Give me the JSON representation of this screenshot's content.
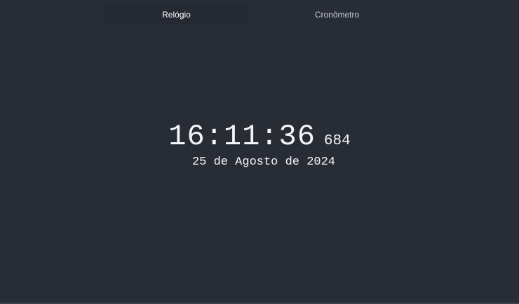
{
  "tabs": [
    {
      "label": "Relógio",
      "active": true
    },
    {
      "label": "Cronômetro",
      "active": false
    }
  ],
  "clock": {
    "time": "16:11:36",
    "milliseconds": "684",
    "date": "25 de Agosto de 2024"
  },
  "colors": {
    "background": "#282c35",
    "active_tab": "#252931",
    "text": "#f4f5f7"
  }
}
